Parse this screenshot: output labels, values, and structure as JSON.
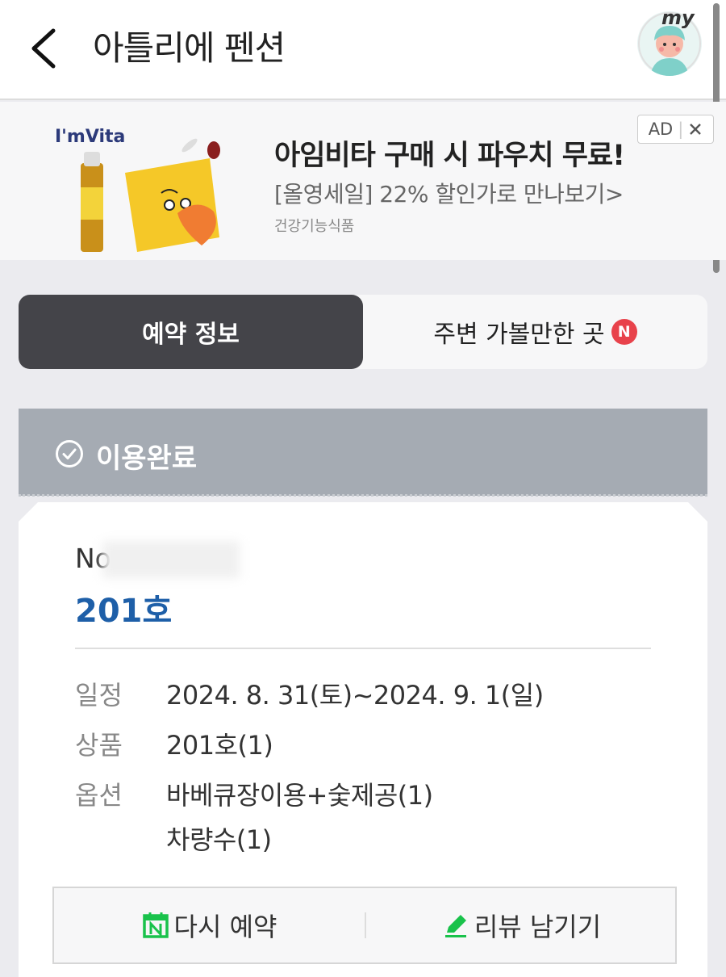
{
  "header": {
    "title": "아틀리에 펜션",
    "avatar_tag": "my"
  },
  "ad": {
    "brand_logo": "I'mVita",
    "title": "아임비타 구매 시 파우치 무료!",
    "subtitle": "[올영세일] 22% 할인가로 만나보기>",
    "category": "건강기능식품",
    "badge": "AD",
    "close_icon": "close-icon"
  },
  "tabs": [
    {
      "label": "예약 정보",
      "active": true
    },
    {
      "label": "주변 가볼만한 곳",
      "active": false,
      "badge": "N"
    }
  ],
  "status": {
    "label": "이용완료",
    "icon": "check-circle-icon"
  },
  "reservation": {
    "number_prefix": "No",
    "room": "201호",
    "rows": [
      {
        "label": "일정",
        "values": [
          "2024. 8. 31(토)~2024. 9. 1(일)"
        ]
      },
      {
        "label": "상품",
        "values": [
          "201호(1)"
        ]
      },
      {
        "label": "옵션",
        "values": [
          "바베큐장이용+숯제공(1)",
          "차량수(1)"
        ]
      }
    ]
  },
  "actions": {
    "rebook": "다시 예약",
    "review": "리뷰 남기기"
  },
  "colors": {
    "accent_blue": "#1e5fa8",
    "tab_dark": "#444449",
    "status_gray": "#a5abb3",
    "new_badge": "#e8424b",
    "rebook_green": "#19c24b"
  }
}
